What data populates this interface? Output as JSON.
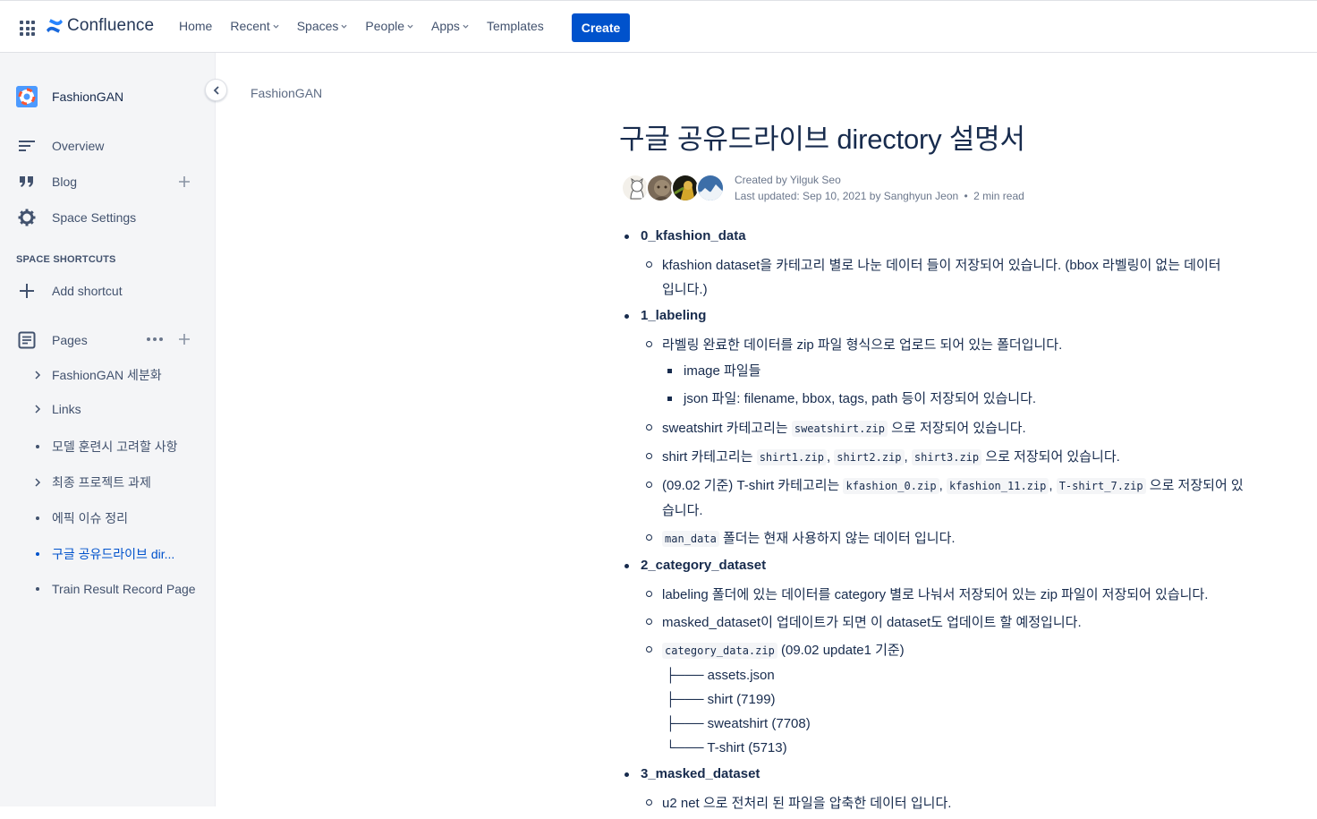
{
  "topnav": {
    "logo": "Confluence",
    "items": [
      {
        "label": "Home",
        "dropdown": false
      },
      {
        "label": "Recent",
        "dropdown": true
      },
      {
        "label": "Spaces",
        "dropdown": true
      },
      {
        "label": "People",
        "dropdown": true
      },
      {
        "label": "Apps",
        "dropdown": true
      },
      {
        "label": "Templates",
        "dropdown": false
      }
    ],
    "create": "Create"
  },
  "sidebar": {
    "space_name": "FashionGAN",
    "overview": "Overview",
    "blog": "Blog",
    "settings": "Space Settings",
    "shortcuts_label": "SPACE SHORTCUTS",
    "add_shortcut": "Add shortcut",
    "pages": "Pages",
    "tree": [
      {
        "label": "FashionGAN 세분화",
        "marker": "chevron"
      },
      {
        "label": "Links",
        "marker": "chevron"
      },
      {
        "label": "모델 훈련시 고려할 사항",
        "marker": "dot"
      },
      {
        "label": "최종 프로젝트 과제",
        "marker": "chevron"
      },
      {
        "label": "에픽 이슈 정리",
        "marker": "dot"
      },
      {
        "label": "구글 공유드라이브 dir...",
        "marker": "dot",
        "active": true
      },
      {
        "label": "Train Result Record Page",
        "marker": "dot"
      }
    ]
  },
  "page": {
    "breadcrumb": "FashionGAN",
    "title": "구글 공유드라이브 directory 설명서",
    "created_by": "Created by Yilguk Seo",
    "last_updated": "Last updated: Sep 10, 2021 by Sanghyun Jeon",
    "read_time": "2 min read"
  },
  "content": {
    "s0": "0_kfashion_data",
    "s0_a1": "kfashion dataset을 카테고리 별로 나눈 데이터 들이 저장되어 있습니다. (bbox 라벨링이 없는 데이터",
    "s0_a2": "입니다.)",
    "s1": "1_labeling",
    "s1_a": "라벨링 완료한 데이터를 zip 파일 형식으로 업로드 되어 있는 폴더입니다.",
    "s1_a_i": "image 파일들",
    "s1_a_j": "json 파일: filename, bbox, tags, path 등이 저장되어 있습니다.",
    "s1_b_pre": "sweatshirt 카테고리는 ",
    "s1_b_code": "sweatshirt.zip",
    "s1_b_post": " 으로 저장되어 있습니다.",
    "s1_c_pre": "shirt 카테고리는 ",
    "s1_c_code1": "shirt1.zip",
    "s1_c_sep1": ", ",
    "s1_c_code2": "shirt2.zip",
    "s1_c_sep2": ", ",
    "s1_c_code3": "shirt3.zip",
    "s1_c_post": " 으로 저장되어 있습니다.",
    "s1_d_pre": "(09.02 기준) T-shirt 카테고리는 ",
    "s1_d_code1": "kfashion_0.zip",
    "s1_d_sep1": ", ",
    "s1_d_code2": "kfashion_11.zip",
    "s1_d_sep2": ", ",
    "s1_d_code3": "T-shirt_7.zip",
    "s1_d_post": " 으로 저장되어 있",
    "s1_d_cont": "습니다.",
    "s1_e_code": "man_data",
    "s1_e_post": " 폴더는 현재 사용하지 않는 데이터 입니다.",
    "s2": "2_category_dataset",
    "s2_a": "labeling 폴더에 있는 데이터를 category 별로 나눠서 저장되어 있는 zip 파일이 저장되어 있습니다.",
    "s2_b": "masked_dataset이 업데이트가 되면 이 dataset도 업데이트 할 예정입니다.",
    "s2_c_code": "category_data.zip",
    "s2_c_post": " (09.02 update1 기준)",
    "s2_tree": [
      "├─── assets.json",
      "├─── shirt (7199)",
      "├─── sweatshirt (7708)",
      "└─── T-shirt (5713)"
    ],
    "s3": "3_masked_dataset",
    "s3_a": "u2 net 으로 전처리 된 파일을 압축한 데이터 입니다."
  }
}
